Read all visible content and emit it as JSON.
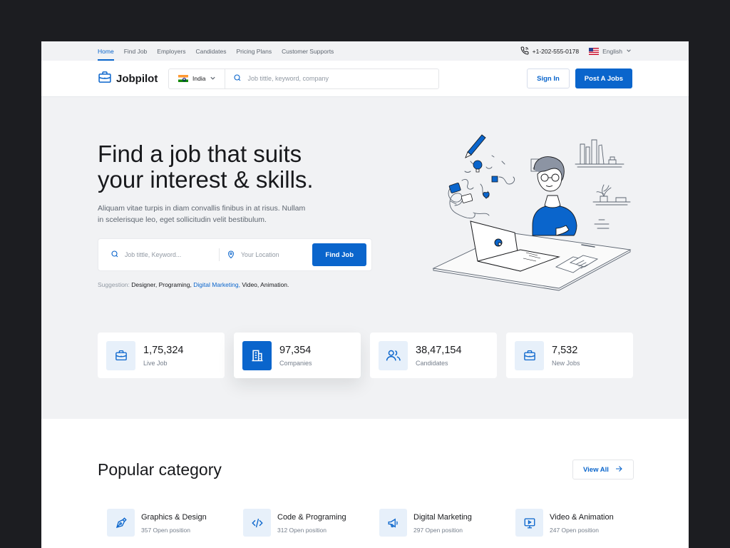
{
  "topbar": {
    "nav": [
      {
        "label": "Home",
        "active": true
      },
      {
        "label": "Find Job"
      },
      {
        "label": "Employers"
      },
      {
        "label": "Candidates"
      },
      {
        "label": "Pricing Plans"
      },
      {
        "label": "Customer Supports"
      }
    ],
    "phone": "+1-202-555-0178",
    "language": "English"
  },
  "header": {
    "brand": "Jobpilot",
    "country": "India",
    "search_placeholder": "Job tittle, keyword, company",
    "sign_in": "Sign In",
    "post_job": "Post A Jobs"
  },
  "hero": {
    "title_line1": "Find a job that suits",
    "title_line2": "your interest & skills.",
    "desc_line1": "Aliquam vitae turpis in diam convallis finibus in at risus. Nullam",
    "desc_line2": "in scelerisque leo, eget sollicitudin velit bestibulum.",
    "keyword_placeholder": "Job tittle, Keyword...",
    "location_placeholder": "Your Location",
    "find_button": "Find Job",
    "suggestion_label": "Suggestion:",
    "suggestions": [
      "Designer,",
      "Programing,",
      "Digital Marketing,",
      "Video,",
      "Animation."
    ]
  },
  "stats": [
    {
      "value": "1,75,324",
      "label": "Live Job",
      "icon": "briefcase-icon"
    },
    {
      "value": "97,354",
      "label": "Companies",
      "icon": "building-icon"
    },
    {
      "value": "38,47,154",
      "label": "Candidates",
      "icon": "users-icon"
    },
    {
      "value": "7,532",
      "label": "New Jobs",
      "icon": "briefcase-icon"
    }
  ],
  "popular": {
    "title": "Popular category",
    "view_all": "View All",
    "categories": [
      {
        "title": "Graphics & Design",
        "sub": "357 Open position",
        "icon": "pen-nib-icon"
      },
      {
        "title": "Code & Programing",
        "sub": "312 Open position",
        "icon": "code-icon"
      },
      {
        "title": "Digital Marketing",
        "sub": "297 Open position",
        "icon": "megaphone-icon"
      },
      {
        "title": "Video & Animation",
        "sub": "247 Open position",
        "icon": "monitor-play-icon"
      }
    ]
  },
  "colors": {
    "primary": "#0a65cc",
    "hero_bg": "#f1f2f4",
    "light_blue": "#e7f0fa"
  }
}
